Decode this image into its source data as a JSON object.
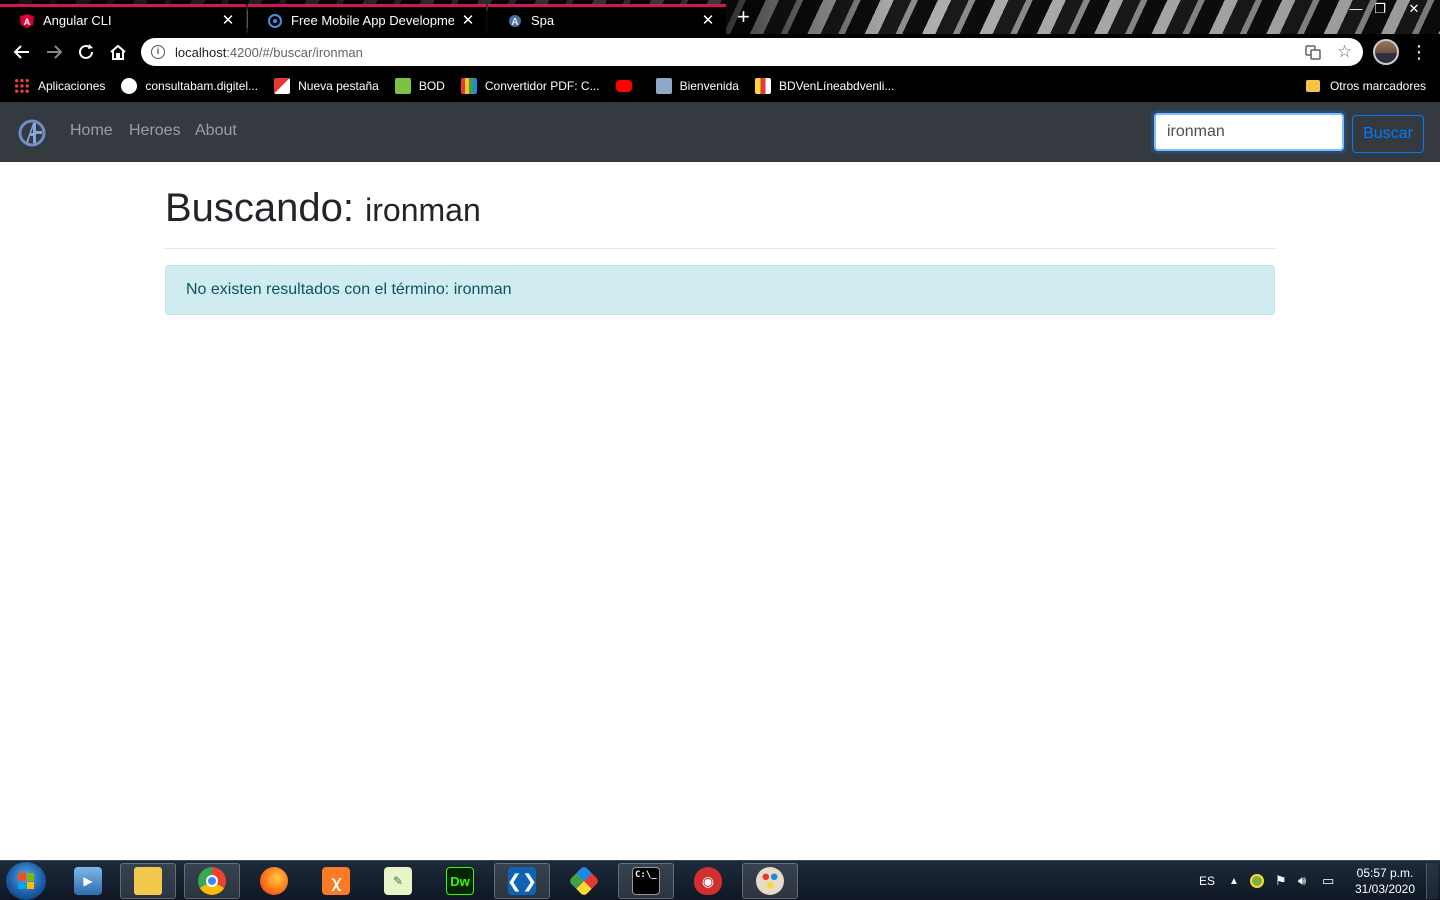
{
  "browser": {
    "tabs": [
      {
        "title": "Angular CLI"
      },
      {
        "title": "Free Mobile App Development: C"
      },
      {
        "title": "Spa"
      }
    ],
    "url_host": "localhost",
    "url_path": ":4200/#/buscar/ironman"
  },
  "bookmarks": {
    "items": [
      {
        "label": "Aplicaciones"
      },
      {
        "label": "consultabam.digitel..."
      },
      {
        "label": "Nueva pestaña"
      },
      {
        "label": "BOD"
      },
      {
        "label": "Convertidor PDF: C..."
      },
      {
        "label": ""
      },
      {
        "label": "Bienvenida"
      },
      {
        "label": "BDVenLíneabdvenli..."
      }
    ],
    "other": "Otros marcadores"
  },
  "navbar": {
    "links": [
      "Home",
      "Heroes",
      "About"
    ],
    "search_value": "ironman",
    "search_button": "Buscar"
  },
  "main": {
    "heading_label": "Buscando:",
    "heading_term": "ironman",
    "alert_text": "No existen resultados con el término: ironman"
  },
  "taskbar": {
    "language": "ES",
    "time": "05:57 p.m.",
    "date": "31/03/2020"
  }
}
